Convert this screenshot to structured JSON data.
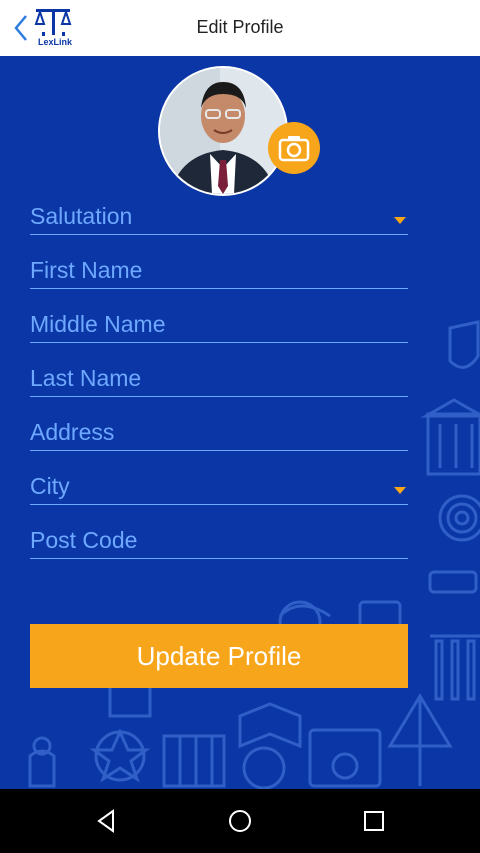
{
  "header": {
    "title": "Edit Profile",
    "logo_text": "LexLink",
    "back_icon": "chevron-left-icon",
    "logo_icon": "scales-of-justice-icon"
  },
  "profile": {
    "avatar_alt": "profile-photo",
    "camera_icon": "camera-icon"
  },
  "form": {
    "salutation_placeholder": "Salutation",
    "first_name_placeholder": "First Name",
    "middle_name_placeholder": "Middle Name",
    "last_name_placeholder": "Last Name",
    "address_placeholder": "Address",
    "city_placeholder": "City",
    "post_code_placeholder": "Post Code"
  },
  "actions": {
    "update_label": "Update Profile"
  },
  "navbar": {
    "back_icon": "triangle-back-icon",
    "home_icon": "circle-home-icon",
    "recents_icon": "square-recents-icon"
  },
  "colors": {
    "primary": "#0a37a5",
    "accent": "#f7a51a",
    "field_line": "#6ea8ff"
  }
}
